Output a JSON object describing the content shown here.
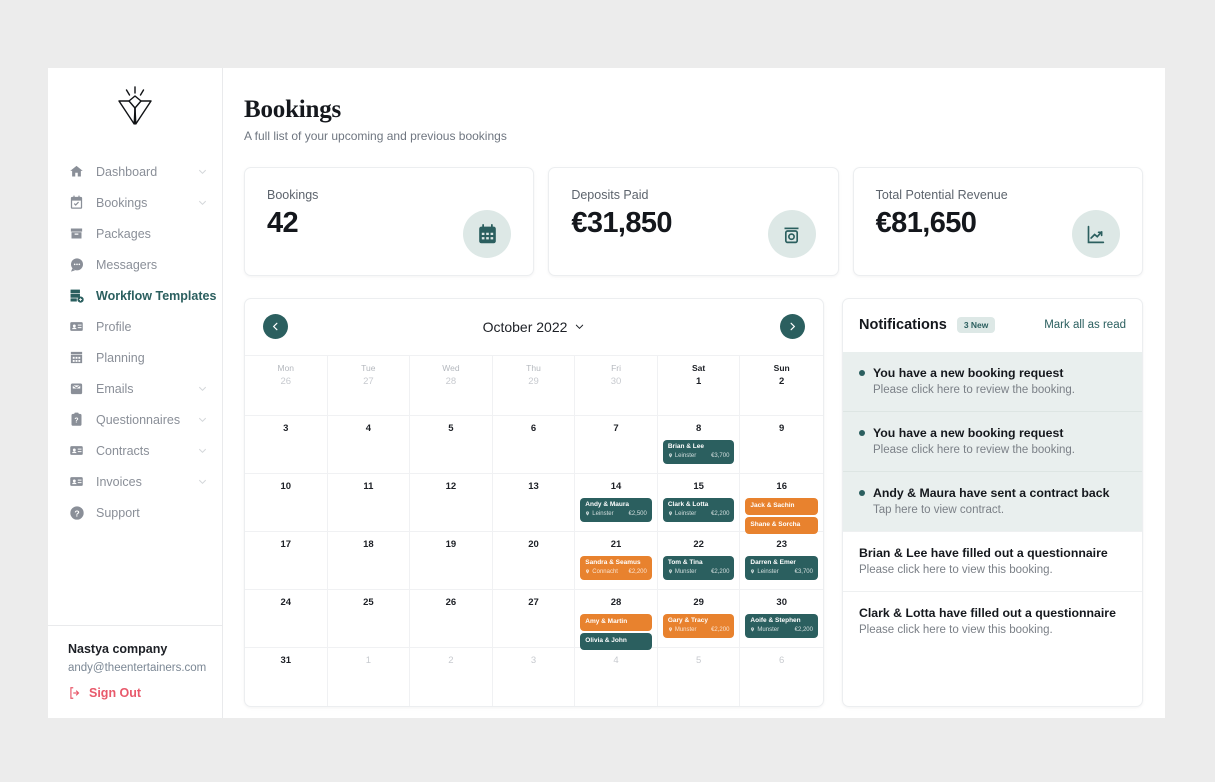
{
  "sidebar": {
    "logo_icon": "diamond-w-logo",
    "items": [
      {
        "label": "Dashboard",
        "icon": "home-icon",
        "chevron": true,
        "active": false
      },
      {
        "label": "Bookings",
        "icon": "calendar-check-icon",
        "chevron": true,
        "active": false
      },
      {
        "label": "Packages",
        "icon": "box-icon",
        "chevron": false,
        "active": false
      },
      {
        "label": "Messagers",
        "icon": "chat-icon",
        "chevron": false,
        "active": false
      },
      {
        "label": "Workflow Templates",
        "icon": "workflow-icon",
        "chevron": false,
        "active": true
      },
      {
        "label": "Profile",
        "icon": "id-card-icon",
        "chevron": false,
        "active": false
      },
      {
        "label": "Planning",
        "icon": "calendar-grid-icon",
        "chevron": false,
        "active": false
      },
      {
        "label": "Emails",
        "icon": "mail-briefcase-icon",
        "chevron": true,
        "active": false
      },
      {
        "label": "Questionnaires",
        "icon": "clipboard-question-icon",
        "chevron": true,
        "active": false
      },
      {
        "label": "Contracts",
        "icon": "id-card-icon",
        "chevron": true,
        "active": false
      },
      {
        "label": "Invoices",
        "icon": "id-card-icon",
        "chevron": true,
        "active": false
      },
      {
        "label": "Support",
        "icon": "help-circle-icon",
        "chevron": false,
        "active": false
      }
    ],
    "footer": {
      "company": "Nastya company",
      "email": "andy@theentertainers.com",
      "sign_out": "Sign Out",
      "sign_out_icon": "sign-out-icon"
    }
  },
  "header": {
    "title": "Bookings",
    "subtitle": "A full list of your upcoming and previous bookings"
  },
  "stats": [
    {
      "label": "Bookings",
      "value": "42",
      "icon": "calendar-icon"
    },
    {
      "label": "Deposits Paid",
      "value": "€31,850",
      "icon": "deposit-icon"
    },
    {
      "label": "Total Potential Revenue",
      "value": "€81,650",
      "icon": "chart-line-icon"
    }
  ],
  "calendar": {
    "prev_icon": "chevron-left-icon",
    "next_icon": "chevron-right-icon",
    "month_label": "October 2022",
    "month_chevron_icon": "chevron-down-icon",
    "weekdays": [
      {
        "name": "Mon",
        "bold": false
      },
      {
        "name": "Tue",
        "bold": false
      },
      {
        "name": "Wed",
        "bold": false
      },
      {
        "name": "Thu",
        "bold": false
      },
      {
        "name": "Fri",
        "bold": false
      },
      {
        "name": "Sat",
        "bold": true
      },
      {
        "name": "Sun",
        "bold": true
      }
    ],
    "weeks": [
      [
        {
          "day": "26",
          "muted": true,
          "events": []
        },
        {
          "day": "27",
          "muted": true,
          "events": []
        },
        {
          "day": "28",
          "muted": true,
          "events": []
        },
        {
          "day": "29",
          "muted": true,
          "events": []
        },
        {
          "day": "30",
          "muted": true,
          "events": []
        },
        {
          "day": "1",
          "muted": false,
          "events": []
        },
        {
          "day": "2",
          "muted": false,
          "events": []
        }
      ],
      [
        {
          "day": "3",
          "muted": false,
          "events": []
        },
        {
          "day": "4",
          "muted": false,
          "events": []
        },
        {
          "day": "5",
          "muted": false,
          "events": []
        },
        {
          "day": "6",
          "muted": false,
          "events": []
        },
        {
          "day": "7",
          "muted": false,
          "events": []
        },
        {
          "day": "8",
          "muted": false,
          "events": [
            {
              "title": "Brian & Lee",
              "location": "Leinster",
              "amount": "€3,700",
              "color": "teal"
            }
          ]
        },
        {
          "day": "9",
          "muted": false,
          "events": []
        }
      ],
      [
        {
          "day": "10",
          "muted": false,
          "events": []
        },
        {
          "day": "11",
          "muted": false,
          "events": []
        },
        {
          "day": "12",
          "muted": false,
          "events": []
        },
        {
          "day": "13",
          "muted": false,
          "events": []
        },
        {
          "day": "14",
          "muted": false,
          "events": [
            {
              "title": "Andy & Maura",
              "location": "Leinster",
              "amount": "€2,500",
              "color": "teal"
            }
          ]
        },
        {
          "day": "15",
          "muted": false,
          "events": [
            {
              "title": "Clark & Lotta",
              "location": "Leinster",
              "amount": "€2,200",
              "color": "teal"
            }
          ]
        },
        {
          "day": "16",
          "muted": false,
          "events": [
            {
              "title": "Jack & Sachin",
              "location": "",
              "amount": "",
              "color": "orange"
            },
            {
              "title": "Shane & Sorcha",
              "location": "",
              "amount": "",
              "color": "orange"
            }
          ]
        }
      ],
      [
        {
          "day": "17",
          "muted": false,
          "events": []
        },
        {
          "day": "18",
          "muted": false,
          "events": []
        },
        {
          "day": "19",
          "muted": false,
          "events": []
        },
        {
          "day": "20",
          "muted": false,
          "events": []
        },
        {
          "day": "21",
          "muted": false,
          "events": [
            {
              "title": "Sandra & Seamus",
              "location": "Connacht",
              "amount": "€2,200",
              "color": "orange"
            }
          ]
        },
        {
          "day": "22",
          "muted": false,
          "events": [
            {
              "title": "Tom & Tina",
              "location": "Munster",
              "amount": "€2,200",
              "color": "teal"
            }
          ]
        },
        {
          "day": "23",
          "muted": false,
          "events": [
            {
              "title": "Darren & Emer",
              "location": "Leinster",
              "amount": "€3,700",
              "color": "teal"
            }
          ]
        }
      ],
      [
        {
          "day": "24",
          "muted": false,
          "events": []
        },
        {
          "day": "25",
          "muted": false,
          "events": []
        },
        {
          "day": "26",
          "muted": false,
          "events": []
        },
        {
          "day": "27",
          "muted": false,
          "events": []
        },
        {
          "day": "28",
          "muted": false,
          "events": [
            {
              "title": "Amy & Martin",
              "location": "",
              "amount": "",
              "color": "orange"
            },
            {
              "title": "Olivia & John",
              "location": "",
              "amount": "",
              "color": "teal"
            }
          ]
        },
        {
          "day": "29",
          "muted": false,
          "events": [
            {
              "title": "Gary & Tracy",
              "location": "Munster",
              "amount": "€2,200",
              "color": "orange"
            }
          ]
        },
        {
          "day": "30",
          "muted": false,
          "events": [
            {
              "title": "Aoife & Stephen",
              "location": "Munster",
              "amount": "€2,200",
              "color": "teal"
            }
          ]
        }
      ],
      [
        {
          "day": "31",
          "muted": false,
          "events": []
        },
        {
          "day": "1",
          "muted": true,
          "events": []
        },
        {
          "day": "2",
          "muted": true,
          "events": []
        },
        {
          "day": "3",
          "muted": true,
          "events": []
        },
        {
          "day": "4",
          "muted": true,
          "events": []
        },
        {
          "day": "5",
          "muted": true,
          "events": []
        },
        {
          "day": "6",
          "muted": true,
          "events": []
        }
      ]
    ]
  },
  "notifications": {
    "title": "Notifications",
    "badge": "3 New",
    "mark_all": "Mark all as read",
    "items": [
      {
        "heading": "You have a new booking request",
        "body": "Please click here to review the booking.",
        "unread": true
      },
      {
        "heading": "You have a new booking request",
        "body": "Please click here to review the booking.",
        "unread": true
      },
      {
        "heading": "Andy & Maura have sent a contract back",
        "body": "Tap here to view contract.",
        "unread": true
      },
      {
        "heading": "Brian & Lee have filled out a questionnaire",
        "body": "Please click here to view this booking.",
        "unread": false
      },
      {
        "heading": "Clark & Lotta have filled out a questionnaire",
        "body": "Please click here to view this booking.",
        "unread": false
      }
    ]
  },
  "colors": {
    "teal": "#2b5f5f",
    "orange": "#e8822e",
    "teal_light": "#dde8e6",
    "red": "#e8596b"
  }
}
